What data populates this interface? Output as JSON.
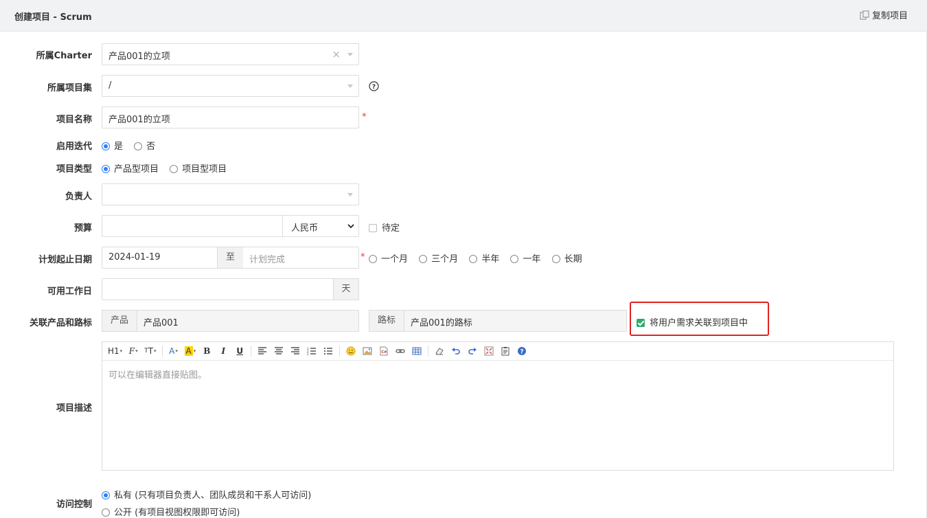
{
  "header": {
    "title": "创建项目 - Scrum",
    "copy_label": "复制项目"
  },
  "form": {
    "charter": {
      "label": "所属Charter",
      "value": "产品001的立项"
    },
    "program": {
      "label": "所属项目集",
      "value": "/"
    },
    "name": {
      "label": "项目名称",
      "value": "产品001的立项"
    },
    "iteration": {
      "label": "启用迭代",
      "options": [
        "是",
        "否"
      ],
      "selected": "是"
    },
    "type": {
      "label": "项目类型",
      "options": [
        "产品型项目",
        "项目型项目"
      ],
      "selected": "产品型项目"
    },
    "owner": {
      "label": "负责人",
      "value": ""
    },
    "budget": {
      "label": "预算",
      "value": "",
      "currency": "人民币",
      "tbd_label": "待定"
    },
    "dates": {
      "label": "计划起止日期",
      "begin": "2024-01-19",
      "to_label": "至",
      "end_placeholder": "计划完成",
      "options": [
        "一个月",
        "三个月",
        "半年",
        "一年",
        "长期"
      ]
    },
    "workdays": {
      "label": "可用工作日",
      "value": "",
      "unit": "天"
    },
    "products": {
      "label": "关联产品和路标",
      "product_tag": "产品",
      "product_value": "产品001",
      "roadmap_tag": "路标",
      "roadmap_value": "产品001的路标",
      "link_stories_label": "将用户需求关联到项目中",
      "link_stories_checked": true
    },
    "description": {
      "label": "项目描述",
      "placeholder": "可以在编辑器直接贴图。"
    },
    "acl": {
      "label": "访问控制",
      "options": [
        "私有 (只有项目负责人、团队成员和干系人可访问)",
        "公开 (有项目视图权限即可访问)"
      ],
      "selected": 0
    }
  },
  "colors": {
    "accent": "#2e7ff8",
    "required": "#e4393c",
    "highlight": "#e02020",
    "check": "#30ab6b"
  }
}
